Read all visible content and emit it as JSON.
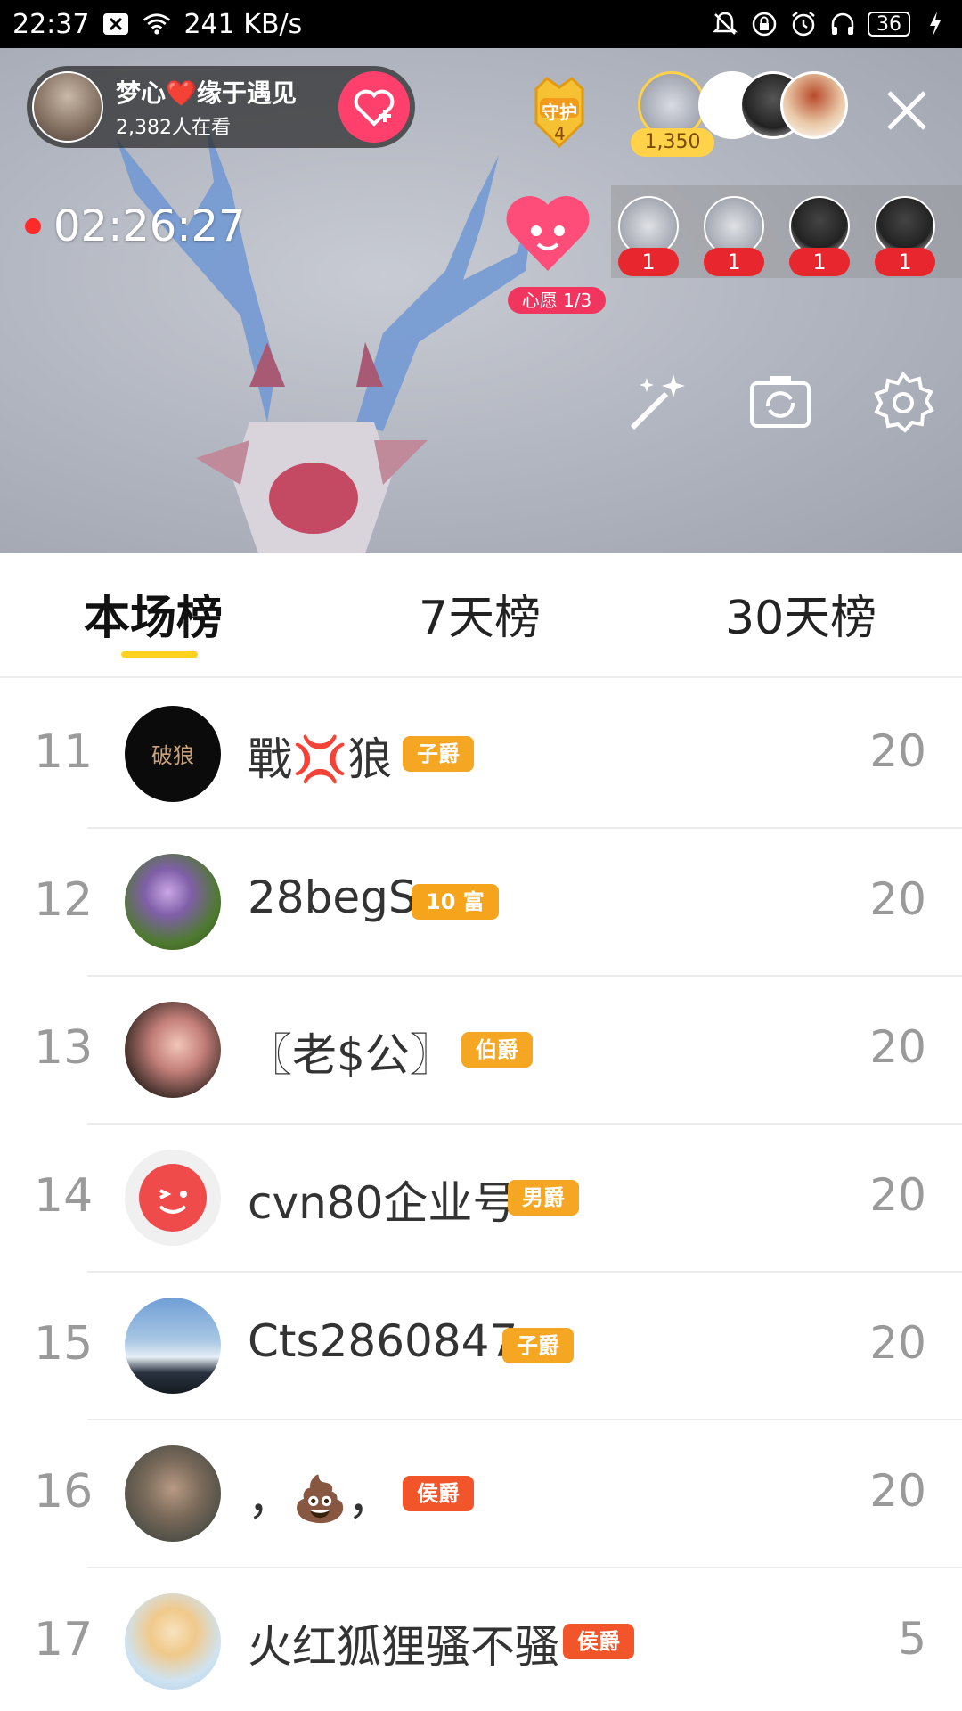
{
  "status_bar": {
    "time": "22:37",
    "speed": "241 KB/s",
    "battery": "36",
    "icons": [
      "notification-x-icon",
      "wifi-icon",
      "bell-muted-icon",
      "lock-rotation-icon",
      "alarm-icon",
      "headphones-icon",
      "battery-icon",
      "charging-icon"
    ]
  },
  "live": {
    "host": {
      "name": "梦心❤️缘于遇见",
      "viewers": "2,382人在看"
    },
    "guard": {
      "label": "守护",
      "count": "4"
    },
    "top_viewer_score": "1,350",
    "timer": "02:26:27",
    "wish": {
      "label": "心愿 1/3"
    },
    "gift_counts": [
      "1",
      "1",
      "1",
      "1"
    ],
    "tools": [
      "magic-wand-icon",
      "switch-camera-icon",
      "settings-gear-icon"
    ]
  },
  "tabs": [
    {
      "label": "本场榜",
      "active": true
    },
    {
      "label": "7天榜",
      "active": false
    },
    {
      "label": "30天榜",
      "active": false
    }
  ],
  "colors": {
    "accent": "#ffd21f",
    "follow": "#ff3f6c",
    "gift_red": "#e8262d"
  },
  "rank_list": [
    {
      "rank": "11",
      "name": "戰💢狼",
      "badge": "子爵",
      "score": "20"
    },
    {
      "rank": "12",
      "name": "28begS",
      "badge": "10 富",
      "score": "20"
    },
    {
      "rank": "13",
      "name": "〖老$公〗",
      "badge": "伯爵",
      "score": "20"
    },
    {
      "rank": "14",
      "name": "cvn80企业号",
      "badge": "男爵",
      "score": "20"
    },
    {
      "rank": "15",
      "name": "Cts2860847",
      "badge": "子爵",
      "score": "20"
    },
    {
      "rank": "16",
      "name": "，💩，",
      "badge": "侯爵",
      "score": "20"
    },
    {
      "rank": "17",
      "name": "火红狐狸骚不骚",
      "badge": "侯爵",
      "score": "5"
    }
  ]
}
